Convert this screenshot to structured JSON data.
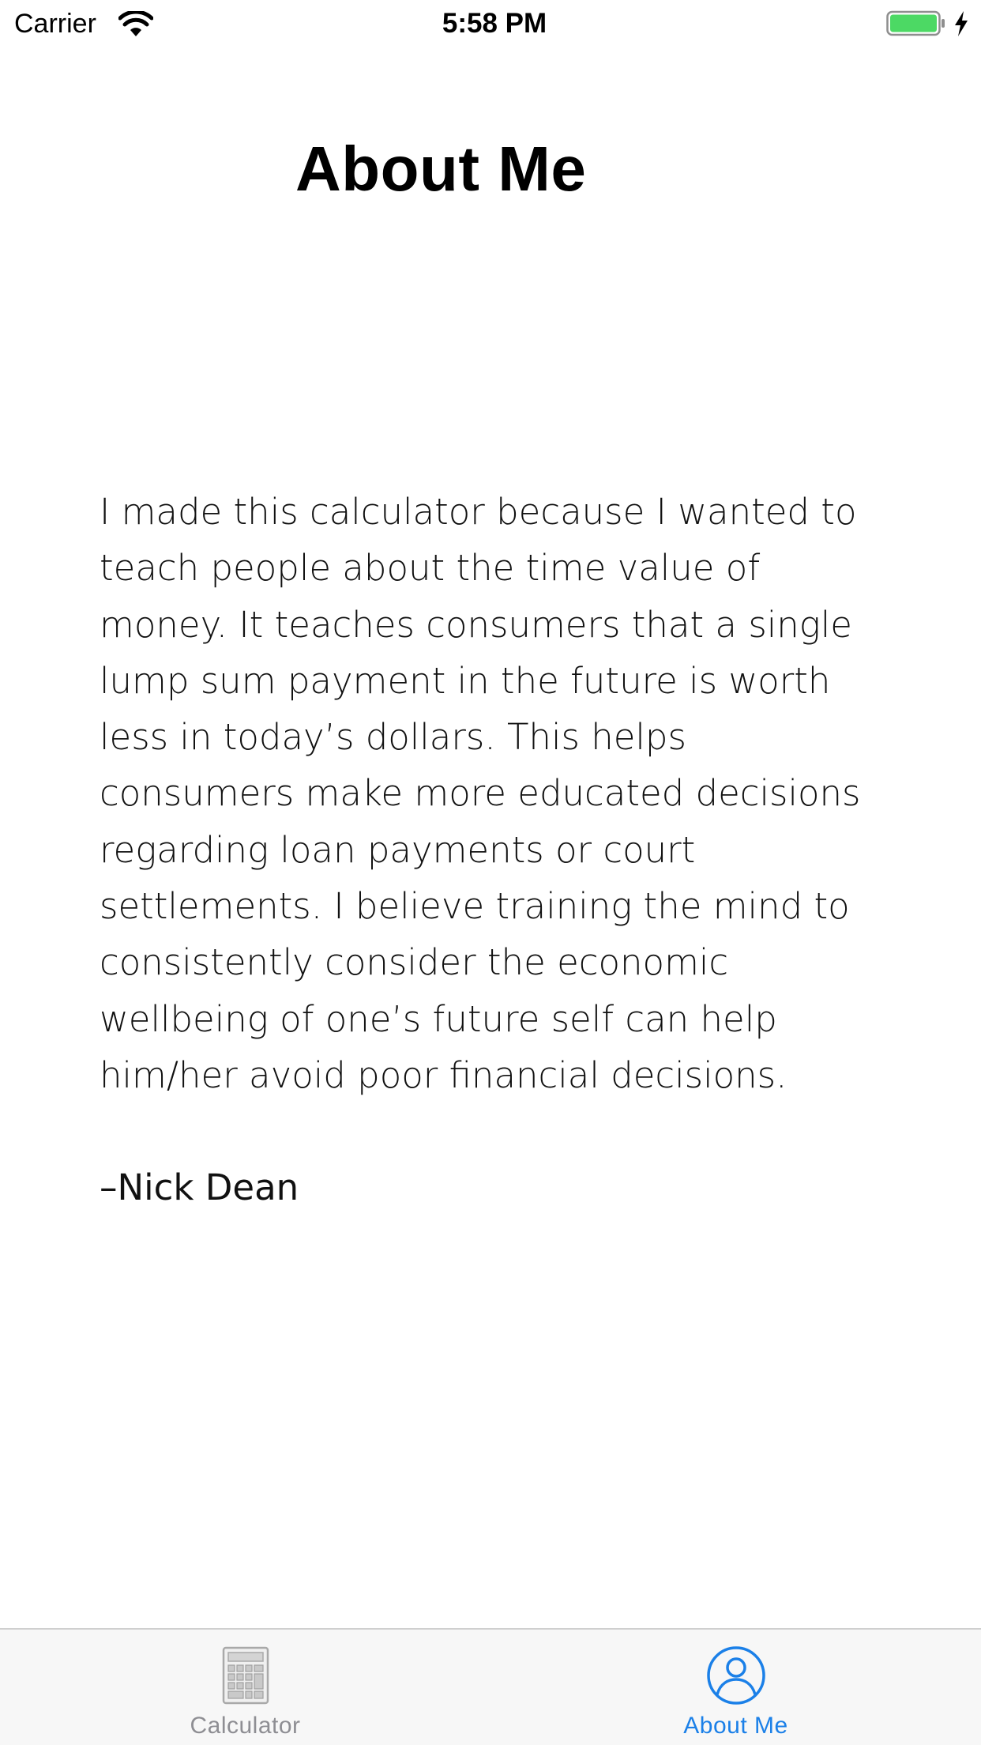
{
  "status_bar": {
    "carrier": "Carrier",
    "time": "5:58 PM",
    "battery_color": "#4cd964",
    "icons": [
      "wifi-icon",
      "battery-icon",
      "charging-bolt-icon"
    ]
  },
  "page": {
    "title": "About Me",
    "body_lines": [
      "I made this calculator because I wanted to",
      "teach people about the time value of",
      "money.  It teaches consumers that a single",
      "lump sum payment in the future is worth",
      "less in today’s dollars. This helps",
      "consumers make more educated decisions",
      "regarding loan payments or court",
      "settlements. I believe training the mind to",
      "consistently consider the  economic",
      "wellbeing of one’s future self can help",
      "him/her avoid poor financial decisions."
    ],
    "signature": "–Nick Dean"
  },
  "tab_bar": {
    "tabs": [
      {
        "label": "Calculator",
        "icon": "calculator-icon",
        "selected": false
      },
      {
        "label": "About Me",
        "icon": "person-icon",
        "selected": true
      }
    ],
    "selected_color": "#1b80e8",
    "unselected_color": "#8e8e93"
  }
}
